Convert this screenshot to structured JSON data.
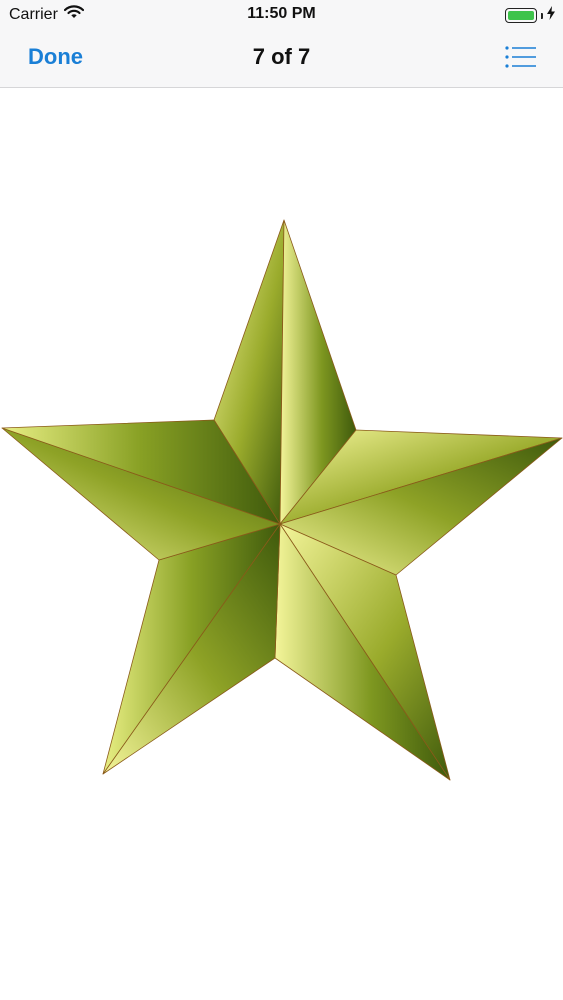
{
  "status_bar": {
    "carrier": "Carrier",
    "time": "11:50 PM",
    "wifi_icon": "wifi-icon",
    "battery_icon": "battery-icon",
    "charging_icon": "charging-bolt-icon",
    "battery_color": "#3ec34a"
  },
  "nav": {
    "done_label": "Done",
    "title": "7 of 7",
    "list_icon": "list-icon",
    "accent_color": "#1a7fd6"
  },
  "content": {
    "image_subject": "star-image",
    "star_colors": {
      "light": "#f4f59a",
      "dark": "#3f5a0c"
    }
  }
}
